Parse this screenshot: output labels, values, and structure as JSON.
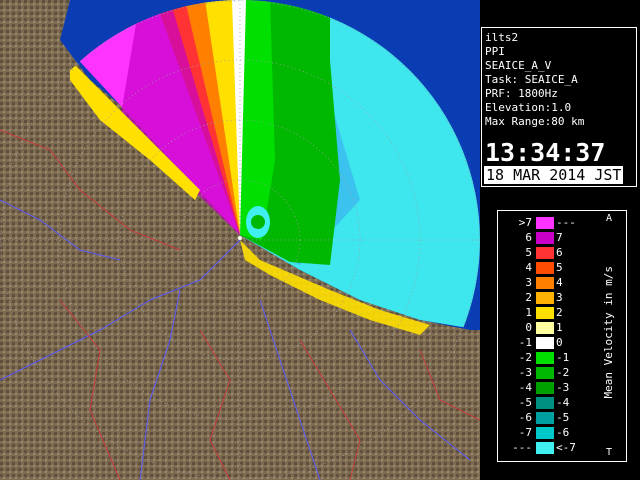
{
  "info": {
    "station": "ilts2",
    "scan_type": "PPI",
    "product": "SEAICE_A_V",
    "task": "Task: SEAICE_A",
    "prf": "PRF: 1800Hz",
    "elevation": "Elevation:1.0",
    "max_range": "Max Range:80 km",
    "time": "13:34:37",
    "date": "18 MAR 2014 JST"
  },
  "legend": {
    "unit_label": "Mean Velocity in m/s",
    "top_glyph": "A",
    "bottom_glyph": "T",
    "rows": [
      {
        "left": ">7",
        "right": "---",
        "color": "#ff33ff"
      },
      {
        "left": "6",
        "right": "7",
        "color": "#c800c8"
      },
      {
        "left": "5",
        "right": "6",
        "color": "#ff3333"
      },
      {
        "left": "4",
        "right": "5",
        "color": "#ff4c00"
      },
      {
        "left": "3",
        "right": "4",
        "color": "#ff8000"
      },
      {
        "left": "2",
        "right": "3",
        "color": "#ffb000"
      },
      {
        "left": "1",
        "right": "2",
        "color": "#ffe000"
      },
      {
        "left": "0",
        "right": "1",
        "color": "#ffffa0"
      },
      {
        "left": "-1",
        "right": "0",
        "color": "#ffffff"
      },
      {
        "left": "-2",
        "right": "-1",
        "color": "#00e000"
      },
      {
        "left": "-3",
        "right": "-2",
        "color": "#00b800"
      },
      {
        "left": "-4",
        "right": "-3",
        "color": "#00a000"
      },
      {
        "left": "-5",
        "right": "-4",
        "color": "#009080"
      },
      {
        "left": "-6",
        "right": "-5",
        "color": "#00a0a0"
      },
      {
        "left": "-7",
        "right": "-6",
        "color": "#00c8c8"
      },
      {
        "left": "---",
        "right": "<-7",
        "color": "#40f0f0"
      }
    ]
  },
  "colors": {
    "ocean": "#0a3cb4",
    "land": "#7a6850",
    "range_ring": "#9aa0a0",
    "river": "#5a5aff",
    "border": "#c83c3c"
  }
}
